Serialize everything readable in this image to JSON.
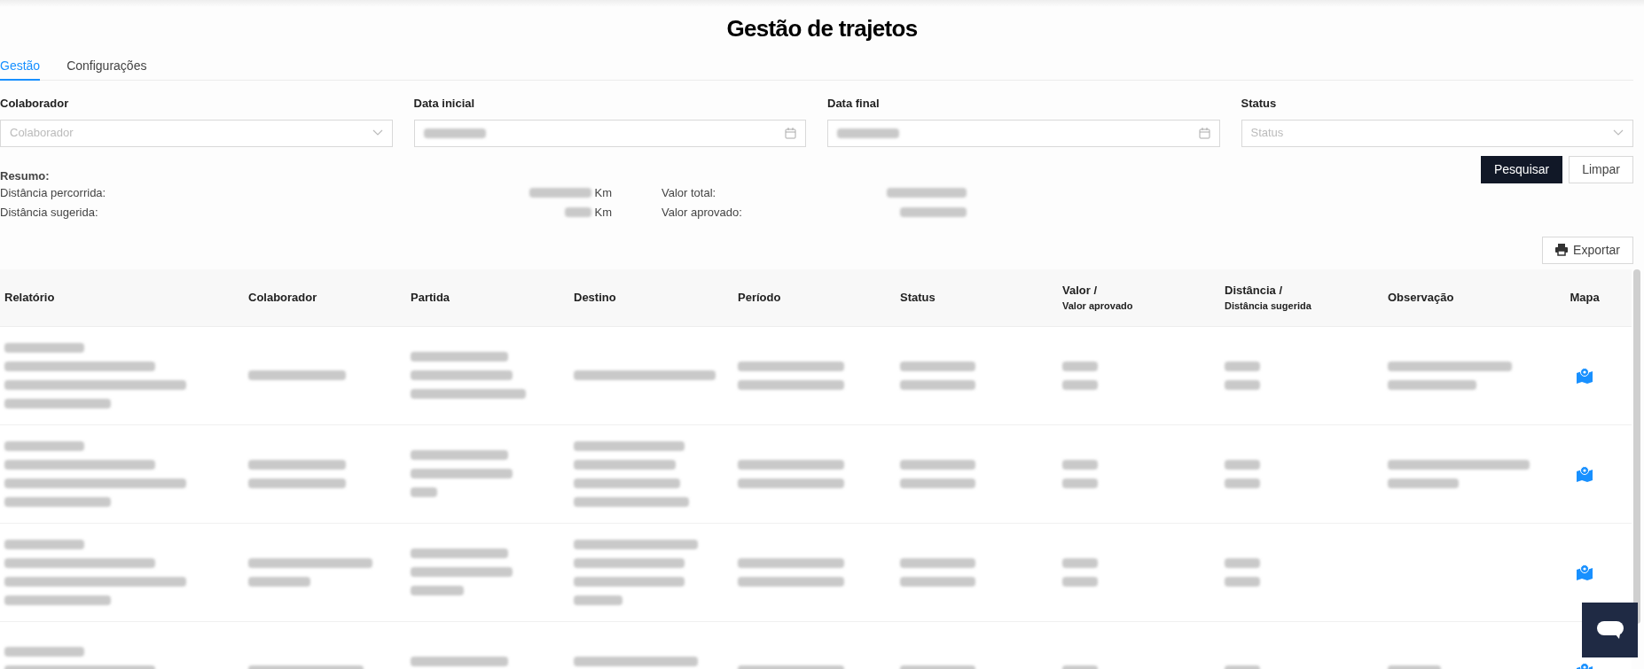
{
  "title": "Gestão de trajetos",
  "tabs": [
    {
      "label": "Gestão",
      "selected": true
    },
    {
      "label": "Configurações",
      "selected": false
    }
  ],
  "filters": [
    {
      "kind": "select",
      "label": "Colaborador",
      "placeholder": "Colaborador"
    },
    {
      "kind": "date",
      "label": "Data inicial"
    },
    {
      "kind": "date",
      "label": "Data final"
    },
    {
      "kind": "select",
      "label": "Status",
      "placeholder": "Status"
    }
  ],
  "summary": {
    "heading": "Resumo:",
    "distance_rows": [
      {
        "label": "Distância percorrida:",
        "unit": "Km"
      },
      {
        "label": "Distância sugerida:",
        "unit": "Km"
      }
    ],
    "value_rows": [
      {
        "label": "Valor total:"
      },
      {
        "label": "Valor aprovado:"
      }
    ]
  },
  "buttons": [
    {
      "kind": "primary",
      "label": "Pesquisar"
    },
    {
      "kind": "secondary",
      "label": "Limpar"
    }
  ],
  "export_button": "Exportar",
  "table": {
    "columns": [
      {
        "label": "Relatório"
      },
      {
        "label": "Colaborador"
      },
      {
        "label": "Partida"
      },
      {
        "label": "Destino"
      },
      {
        "label": "Período"
      },
      {
        "label": "Status"
      },
      {
        "label": "Valor /",
        "sublabel": "Valor aprovado"
      },
      {
        "label": "Distância /",
        "sublabel": "Distância sugerida"
      },
      {
        "label": "Observação"
      },
      {
        "label": "Mapa"
      }
    ]
  }
}
